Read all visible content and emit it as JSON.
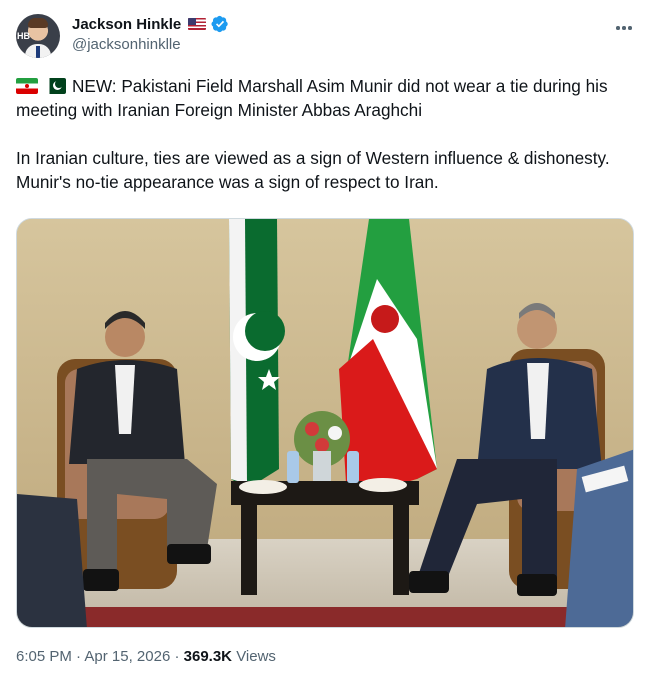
{
  "author": {
    "display_name": "Jackson Hinkle",
    "handle": "@jacksonhinklle",
    "avatar_badge_text": "HB",
    "flag_icon": "us-flag-icon",
    "verified_icon": "verified-badge-icon",
    "verified_color": "#1d9bf0"
  },
  "menu": {
    "icon": "more-horizontal-icon"
  },
  "tweet": {
    "line1_flags": [
      "iran-flag-icon",
      "pakistan-flag-icon"
    ],
    "paragraph1": "NEW: Pakistani Field Marshall Asim Munir did not wear a tie during his meeting with Iranian Foreign Minister Abbas Araghchi",
    "paragraph2": "In Iranian culture, ties are viewed as a sign of Western influence & dishonesty. Munir's no-tie appearance was a sign of respect to Iran."
  },
  "media": {
    "kind": "photo",
    "depicts": [
      "pakistan-flag",
      "iran-flag",
      "two-men-seated-in-armchairs",
      "table-with-flowers-and-water-bottles"
    ]
  },
  "meta": {
    "time": "6:05 PM",
    "separator": "·",
    "date": "Apr 15, 2026",
    "views_count": "369.3K",
    "views_label": "Views"
  },
  "colors": {
    "text_primary": "#0f1419",
    "text_secondary": "#536471",
    "border": "#cfd9de"
  }
}
